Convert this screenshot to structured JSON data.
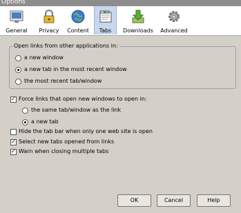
{
  "window": {
    "title": "Options"
  },
  "toolbar": {
    "items": [
      {
        "label": "General",
        "icon": "general-icon",
        "selected": false
      },
      {
        "label": "Privacy",
        "icon": "privacy-lock-icon",
        "selected": false
      },
      {
        "label": "Content",
        "icon": "content-globe-icon",
        "selected": false
      },
      {
        "label": "Tabs",
        "icon": "tabs-icon",
        "selected": true
      },
      {
        "label": "Downloads",
        "icon": "downloads-icon",
        "selected": false
      },
      {
        "label": "Advanced",
        "icon": "advanced-gear-icon",
        "selected": false
      }
    ]
  },
  "links_group": {
    "title": "Open links from other applications in:",
    "options": [
      {
        "label": "a new window",
        "selected": false
      },
      {
        "label": "a new tab in the most recent window",
        "selected": true
      },
      {
        "label": "the most recent tab/window",
        "selected": false
      }
    ]
  },
  "force_links": {
    "label": "Force links that open new windows to open in:",
    "checked": true,
    "options": [
      {
        "label": "the same tab/window as the link",
        "selected": false
      },
      {
        "label": "a new tab",
        "selected": true
      }
    ]
  },
  "checkboxes": [
    {
      "label": "Hide the tab bar when only one web site is open",
      "checked": false
    },
    {
      "label": "Select new tabs opened from links",
      "checked": true
    },
    {
      "label": "Warn when closing multiple tabs",
      "checked": true
    }
  ],
  "buttons": {
    "ok": "OK",
    "cancel": "Cancel",
    "help": "Help"
  }
}
